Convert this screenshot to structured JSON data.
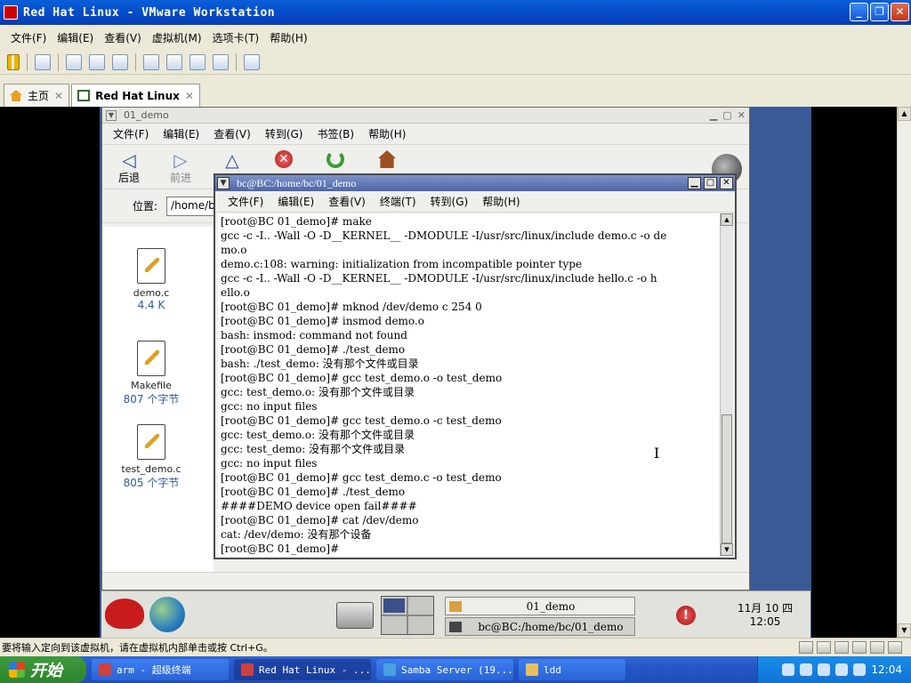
{
  "vmware": {
    "title": "Red Hat Linux - VMware Workstation",
    "menu": [
      "文件(F)",
      "编辑(E)",
      "查看(V)",
      "虚拟机(M)",
      "选项卡(T)",
      "帮助(H)"
    ],
    "tabs": [
      {
        "label": "主页",
        "close": "✕"
      },
      {
        "label": "Red Hat Linux",
        "close": "✕"
      }
    ],
    "status_text": "要将输入定向到该虚拟机，请在虚拟机内部单击或按 Ctrl+G。"
  },
  "nautilus": {
    "title": "01_demo",
    "menu": [
      "文件(F)",
      "编辑(E)",
      "查看(V)",
      "转到(G)",
      "书签(B)",
      "帮助(H)"
    ],
    "toolbar": {
      "back": "后退",
      "forward": "前进"
    },
    "location_label": "位置:",
    "location_value": "/home/bc/01_demo",
    "files": [
      {
        "name": "demo.c",
        "size": "4.4 K"
      },
      {
        "name": "Makefile",
        "size": "807 个字节"
      },
      {
        "name": "test_demo.c",
        "size": "805 个字节"
      }
    ]
  },
  "terminal": {
    "title": "bc@BC:/home/bc/01_demo",
    "menu": [
      "文件(F)",
      "编辑(E)",
      "查看(V)",
      "终端(T)",
      "转到(G)",
      "帮助(H)"
    ],
    "lines": [
      "[root@BC 01_demo]# make",
      "gcc -c -I.. -Wall -O -D__KERNEL__ -DMODULE -I/usr/src/linux/include demo.c -o de",
      "mo.o",
      "demo.c:108: warning: initialization from incompatible pointer type",
      "gcc -c -I.. -Wall -O -D__KERNEL__ -DMODULE -I/usr/src/linux/include hello.c -o h",
      "ello.o",
      "[root@BC 01_demo]# mknod /dev/demo c 254 0",
      "[root@BC 01_demo]# insmod demo.o",
      "bash: insmod: command not found",
      "[root@BC 01_demo]# ./test_demo",
      "bash: ./test_demo: 没有那个文件或目录",
      "[root@BC 01_demo]# gcc test_demo.o -o test_demo",
      "gcc: test_demo.o: 没有那个文件或目录",
      "gcc: no input files",
      "[root@BC 01_demo]# gcc test_demo.o -c test_demo",
      "gcc: test_demo.o: 没有那个文件或目录",
      "gcc: test_demo: 没有那个文件或目录",
      "gcc: no input files",
      "[root@BC 01_demo]# gcc test_demo.c -o test_demo",
      "[root@BC 01_demo]# ./test_demo",
      "####DEMO device open fail####",
      "[root@BC 01_demo]# cat /dev/demo",
      "cat: /dev/demo: 没有那个设备",
      "[root@BC 01_demo]#"
    ]
  },
  "gnome_panel": {
    "tasks": [
      {
        "label": "01_demo",
        "icon": "folder-icon"
      },
      {
        "label": "bc@BC:/home/bc/01_demo",
        "icon": "terminal-icon"
      }
    ],
    "alert": "!",
    "clock_date": "11月 10 四",
    "clock_time": "12:05"
  },
  "xp_taskbar": {
    "start_label": "开始",
    "tasks": [
      {
        "label": "arm - 超级终端",
        "icon": "hyperterminal-icon"
      },
      {
        "label": "Red Hat Linux - ...",
        "icon": "vmware-icon"
      },
      {
        "label": "Samba Server (19...",
        "icon": "samba-icon"
      },
      {
        "label": "ldd",
        "icon": "folder-icon"
      }
    ],
    "clock": "12:04"
  }
}
